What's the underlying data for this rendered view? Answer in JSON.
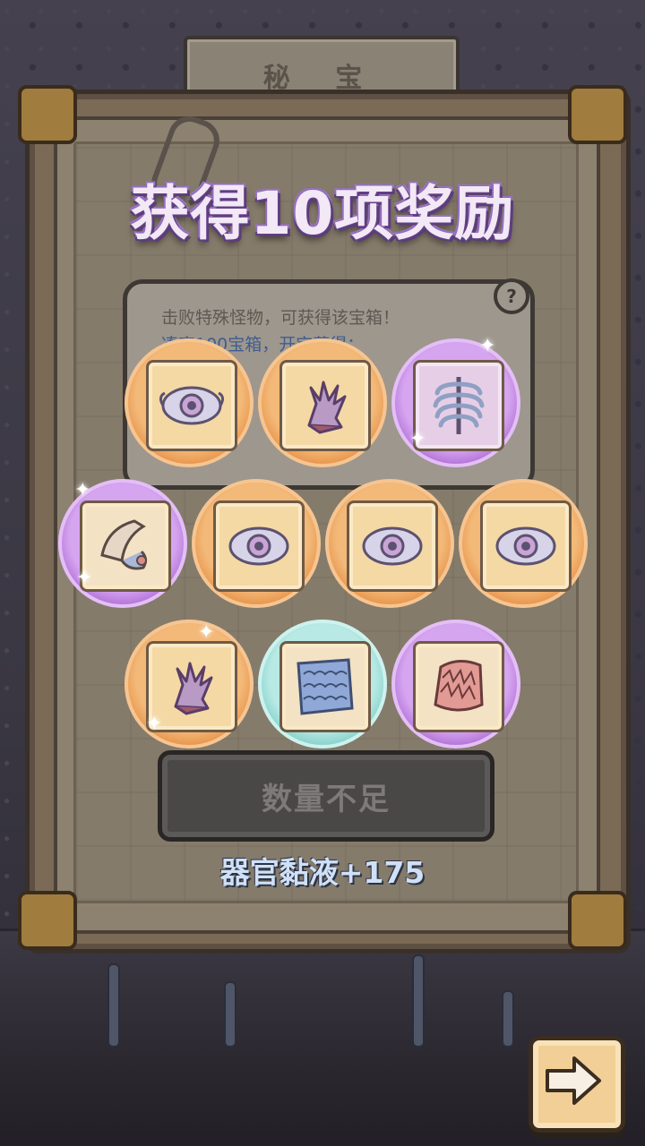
{
  "header": {
    "sign_title": "秘 宝"
  },
  "popup": {
    "headline": "获得10项奖励",
    "info_line1": "击败特殊怪物，可获得该宝箱！",
    "info_line2": "凑齐100宝箱，开宝获得：",
    "help_icon": "?"
  },
  "rewards": [
    {
      "rarity": "orange",
      "icon": "eye-icon"
    },
    {
      "rarity": "orange",
      "icon": "coral-hand-icon"
    },
    {
      "rarity": "purple",
      "icon": "ribcage-icon"
    },
    {
      "rarity": "purple",
      "icon": "shell-horn-icon"
    },
    {
      "rarity": "orange",
      "icon": "eye-icon"
    },
    {
      "rarity": "orange",
      "icon": "eye-icon"
    },
    {
      "rarity": "orange",
      "icon": "eye-icon"
    },
    {
      "rarity": "orange",
      "icon": "coral-hand-icon"
    },
    {
      "rarity": "teal",
      "icon": "fish-scale-icon"
    },
    {
      "rarity": "purple",
      "icon": "feather-scale-icon"
    }
  ],
  "action": {
    "insufficient_label": "数量不足"
  },
  "result": {
    "reward_text": "器官黏液+175"
  },
  "colors": {
    "orange": "#e8944a",
    "purple": "#b272d8",
    "teal": "#86d1cc",
    "headline_outline": "#7c4fa2"
  }
}
